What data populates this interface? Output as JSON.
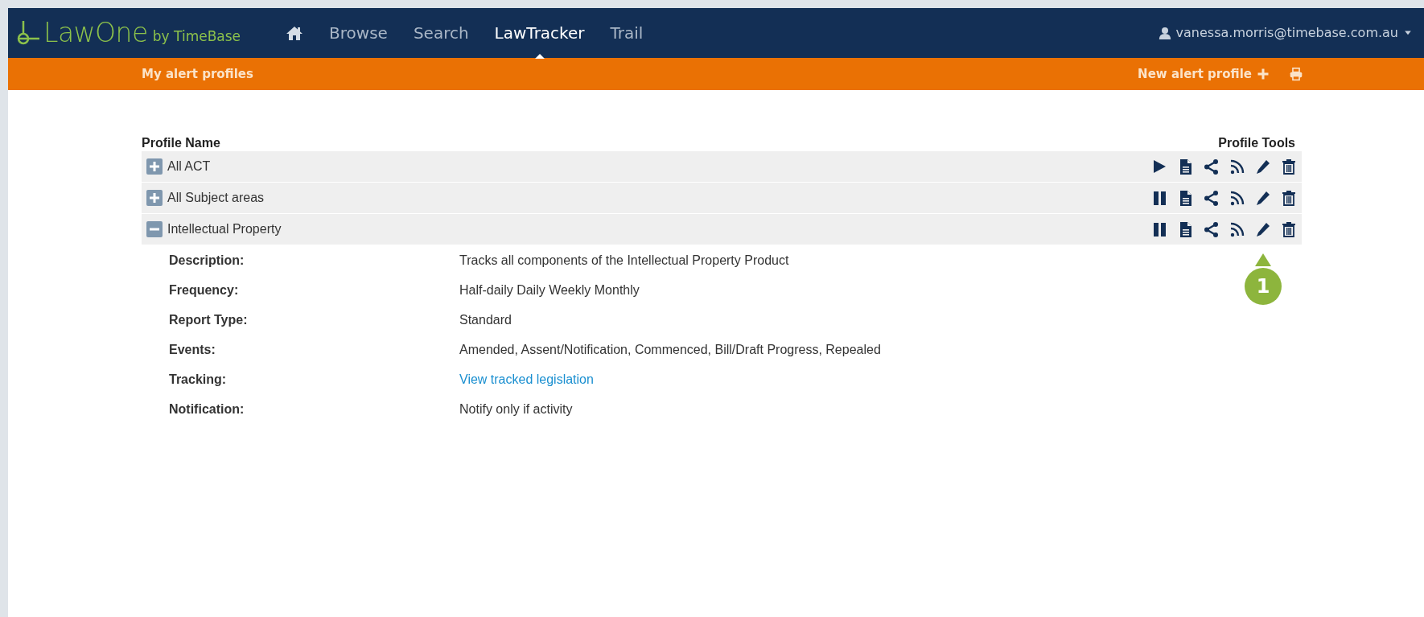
{
  "brand": {
    "name": "LawOne",
    "by": "by TimeBase"
  },
  "nav": [
    {
      "kind": "home",
      "selected": false
    },
    {
      "kind": "link",
      "label": "Browse",
      "selected": false
    },
    {
      "kind": "link",
      "label": "Search",
      "selected": false
    },
    {
      "kind": "link",
      "label": "LawTracker",
      "selected": true
    },
    {
      "kind": "link",
      "label": "Trail",
      "selected": false
    }
  ],
  "user": "vanessa.morris@timebase.com.au",
  "subbar": {
    "title": "My alert profiles",
    "new_profile": "New alert profile"
  },
  "table": {
    "columns": [
      "Profile Name",
      "Profile Tools"
    ],
    "rows": [
      {
        "name": "All ACT",
        "expanded": false,
        "running": false
      },
      {
        "name": "All Subject areas",
        "expanded": false,
        "running": true
      },
      {
        "name": "Intellectual Property",
        "expanded": true,
        "running": true,
        "callout": "1",
        "details": [
          {
            "label": "Description:",
            "value": "Tracks all components of the Intellectual Property Product",
            "kind": "text"
          },
          {
            "label": "Frequency:",
            "value": "Half-daily Daily Weekly Monthly",
            "kind": "text"
          },
          {
            "label": "Report Type:",
            "value": "Standard",
            "kind": "text"
          },
          {
            "label": "Events:",
            "value": "Amended, Assent/Notification, Commenced, Bill/Draft Progress, Repealed",
            "kind": "text"
          },
          {
            "label": "Tracking:",
            "value": "View tracked legislation",
            "kind": "link"
          },
          {
            "label": "Notification:",
            "value": "Notify only if activity",
            "kind": "text"
          }
        ]
      }
    ]
  }
}
